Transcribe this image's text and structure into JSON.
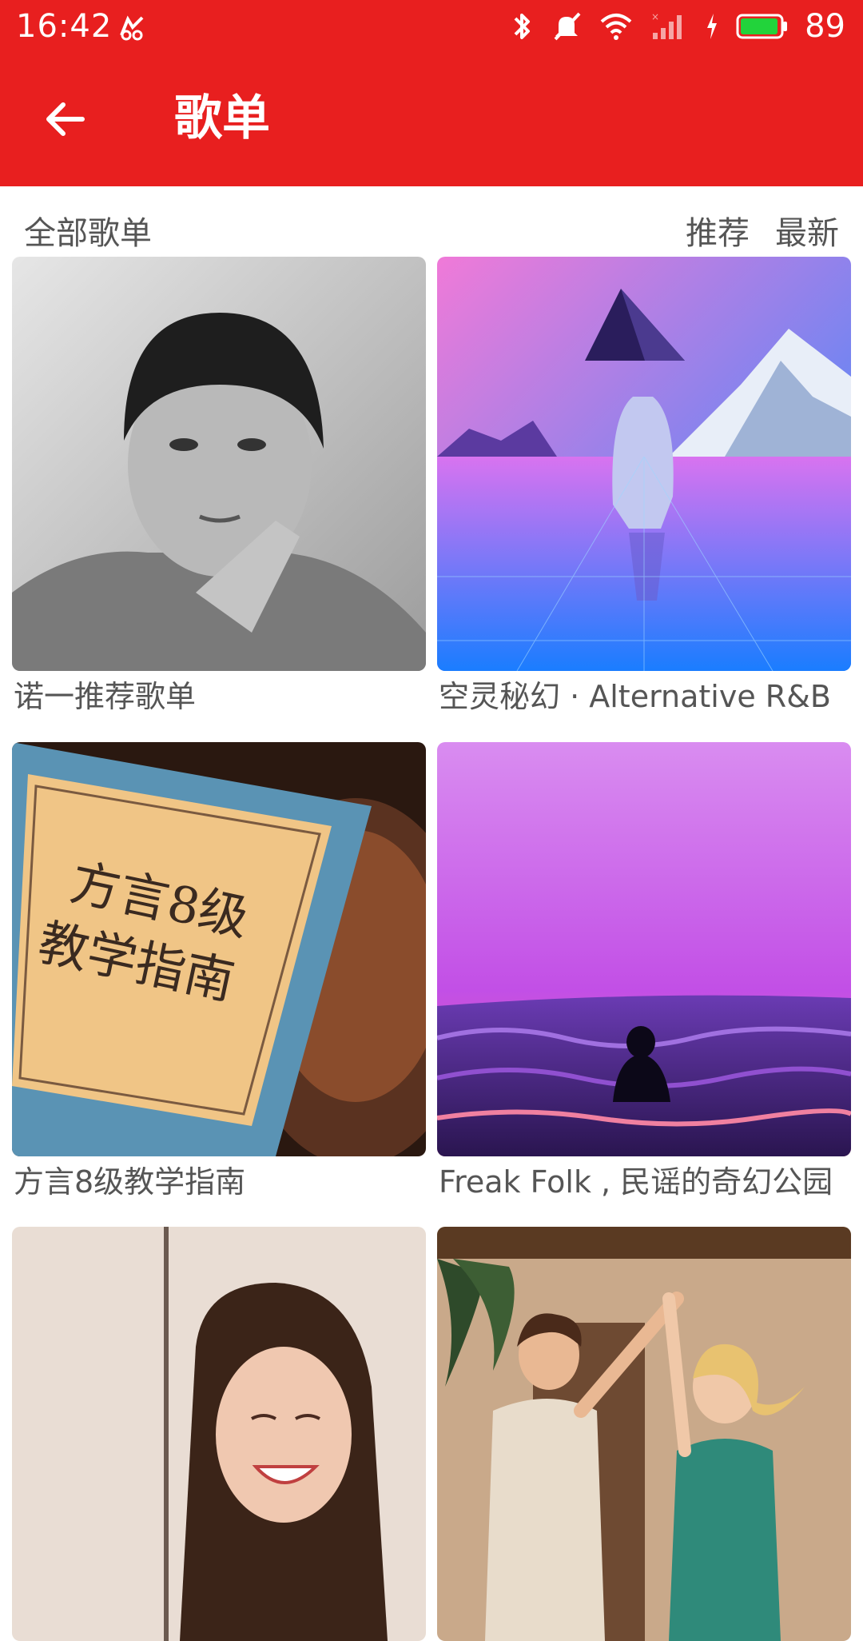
{
  "status_bar": {
    "time": "16:42",
    "battery_percent": "89",
    "icons": [
      "bird-icon",
      "bluetooth-icon",
      "bell-muted-icon",
      "wifi-icon",
      "signal-icon",
      "charging-icon",
      "battery-icon"
    ]
  },
  "app_bar": {
    "title": "歌单",
    "back_icon": "arrow-left-icon",
    "color": "#e81f1f"
  },
  "filters": {
    "all_label": "全部歌单",
    "tabs": [
      "推荐",
      "最新"
    ]
  },
  "playlists": [
    {
      "title": "诺一推荐歌单"
    },
    {
      "title": "空灵秘幻 · Alternative R&B"
    },
    {
      "title": "方言8级教学指南",
      "cover_text": [
        "方言8级",
        "教学指南"
      ]
    },
    {
      "title": "Freak Folk , 民谣的奇幻公园"
    },
    {
      "title": ""
    },
    {
      "title": ""
    }
  ]
}
